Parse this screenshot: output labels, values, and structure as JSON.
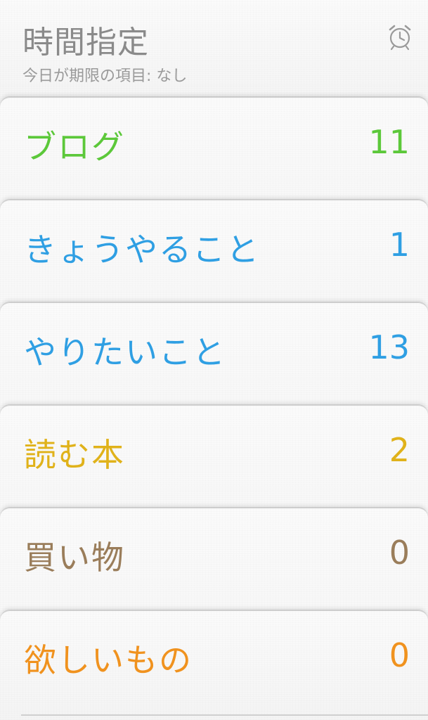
{
  "header": {
    "title": "時間指定",
    "subtitle": "今日が期限の項目: なし",
    "alarm_icon": "alarm-clock-icon"
  },
  "lists": [
    {
      "name": "ブログ",
      "count": "11",
      "color": "#5cc83a"
    },
    {
      "name": "きょうやること",
      "count": "1",
      "color": "#2f9fe3"
    },
    {
      "name": "やりたいこと",
      "count": "13",
      "color": "#2f9fe3"
    },
    {
      "name": "読む本",
      "count": "2",
      "color": "#e0b21a"
    },
    {
      "name": "買い物",
      "count": "0",
      "color": "#9a7d5a"
    },
    {
      "name": "欲しいもの",
      "count": "0",
      "color": "#f0921e"
    }
  ]
}
